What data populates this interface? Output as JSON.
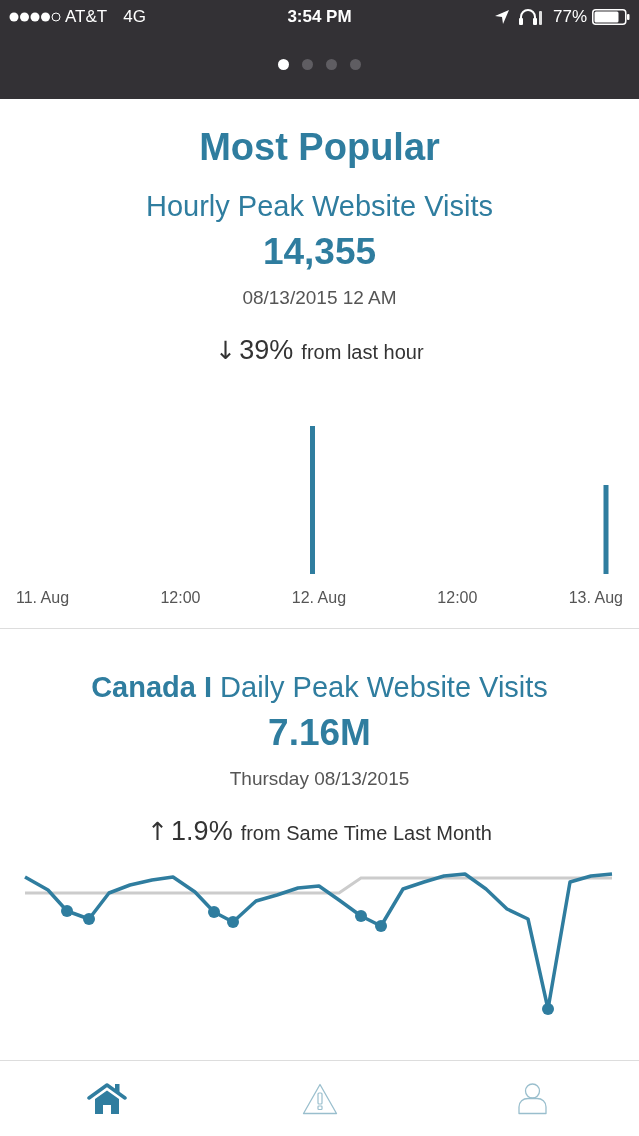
{
  "status_bar": {
    "carrier": "AT&T",
    "network": "4G",
    "time": "3:54 PM",
    "battery": "77%"
  },
  "page_indicator": [
    {
      "selected": true
    },
    {
      "selected": false
    },
    {
      "selected": false
    },
    {
      "selected": false
    }
  ],
  "cards": [
    {
      "title": "Most Popular",
      "subtitle": "Hourly Peak Website Visits",
      "value": "14,355",
      "date": "08/13/2015 12 AM",
      "change": {
        "arrow": "↓",
        "percent": "39%",
        "label": "from last hour"
      },
      "chart": {
        "kind": "bar",
        "x_labels": [
          "11. Aug",
          "12:00",
          "12. Aug",
          "12:00",
          "13. Aug"
        ]
      }
    },
    {
      "subtitle": "**Canada I** Daily Peak Website Visits",
      "value": "7.16M",
      "date": "Thursday 08/13/2015",
      "change": {
        "arrow": "↑",
        "percent": "1.9%",
        "label": "from Same Time Last Month"
      },
      "chart": {
        "kind": "line"
      }
    }
  ],
  "tab_bar": [
    {
      "kind": "home",
      "selected": true
    },
    {
      "kind": "alert",
      "selected": false
    },
    {
      "kind": "profile",
      "selected": false
    }
  ]
}
